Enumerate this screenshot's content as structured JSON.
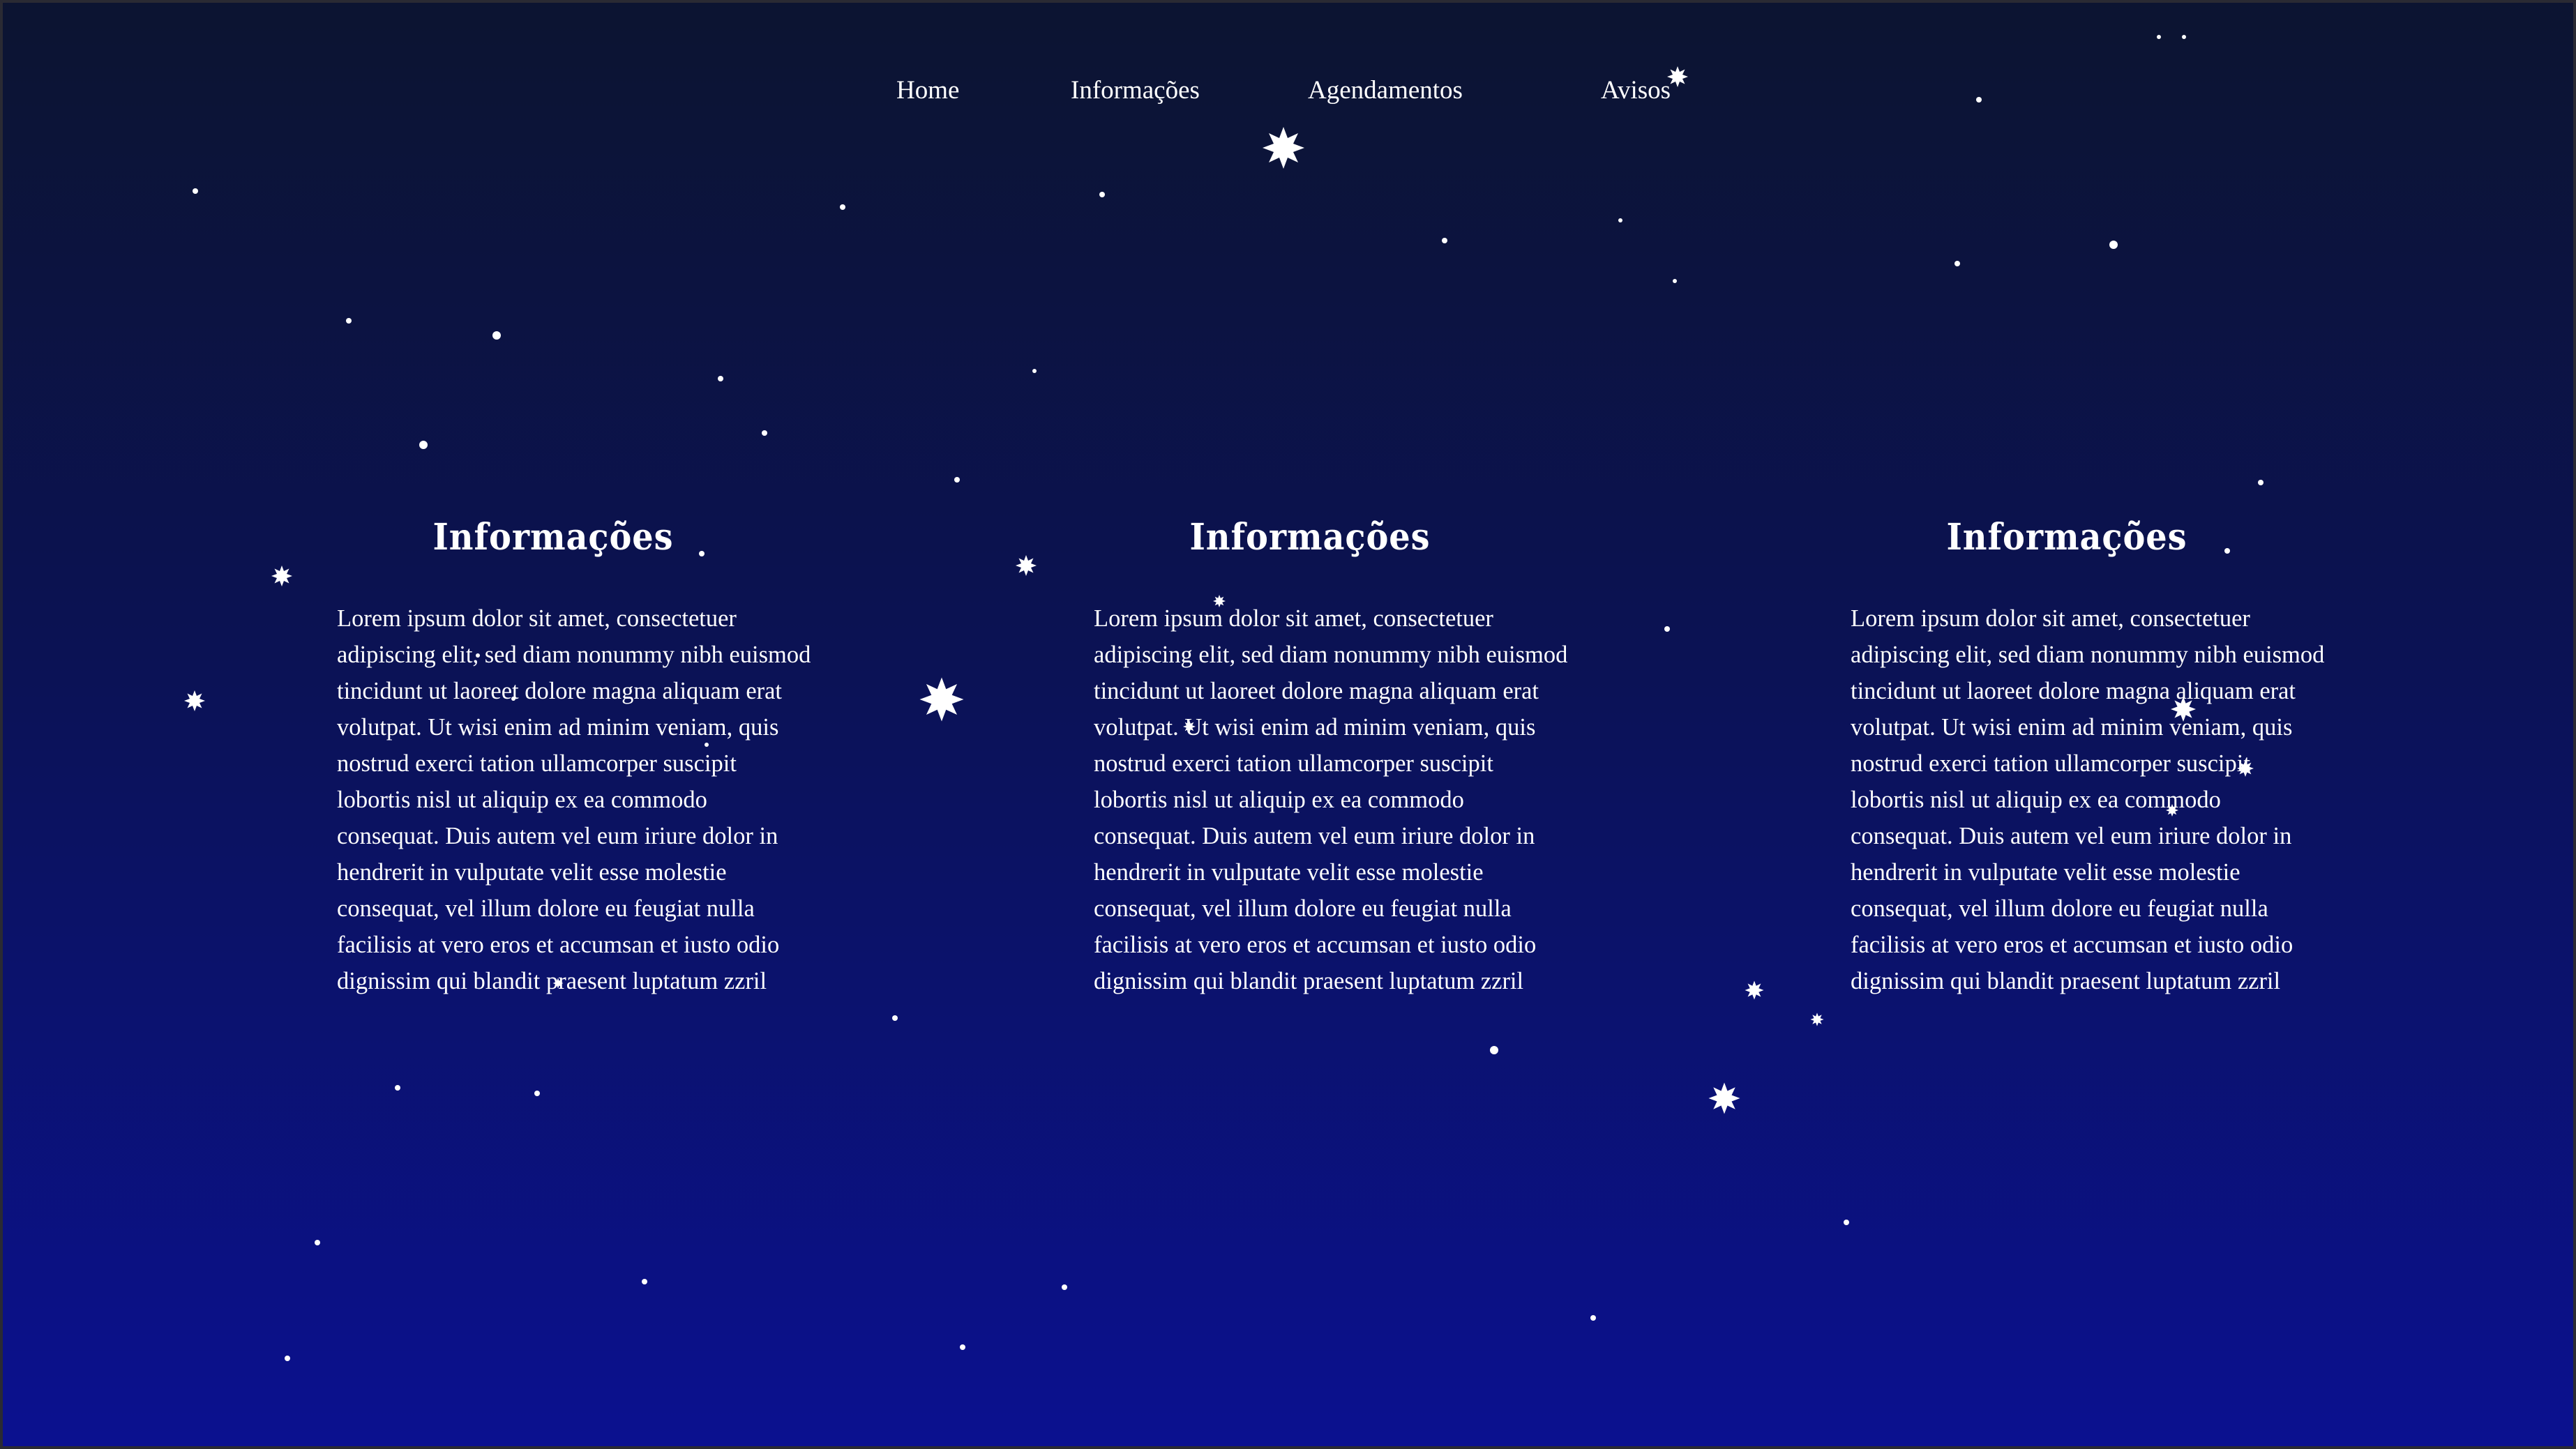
{
  "nav": {
    "items": [
      {
        "label": "Home"
      },
      {
        "label": "Informações"
      },
      {
        "label": "Agendamentos"
      },
      {
        "label": "Avisos"
      }
    ]
  },
  "columns": [
    {
      "title": "Informações",
      "body": "Lorem ipsum dolor sit amet, consectetuer adipiscing elit, sed diam nonummy nibh euismod tincidunt ut laoreet dolore magna aliquam erat volutpat. Ut wisi enim ad minim veniam, quis nostrud exerci tation ullamcorper suscipit lobortis nisl ut aliquip ex ea commodo consequat. Duis autem vel eum iriure dolor in hendrerit in vulputate velit esse molestie consequat, vel illum dolore eu feugiat nulla facilisis at vero eros et accumsan et iusto odio dignissim qui blandit praesent luptatum zzril"
    },
    {
      "title": "Informações",
      "body": "Lorem ipsum dolor sit amet, consectetuer adipiscing elit, sed diam nonummy nibh euismod tincidunt ut laoreet dolore magna aliquam erat volutpat. Ut wisi enim ad minim veniam, quis nostrud exerci tation ullamcorper suscipit lobortis nisl ut aliquip ex ea commodo consequat. Duis autem vel eum iriure dolor in hendrerit in vulputate velit esse molestie consequat, vel illum dolore eu feugiat nulla facilisis at vero eros et accumsan et iusto odio dignissim qui blandit praesent luptatum zzril"
    },
    {
      "title": "Informações",
      "body": "Lorem ipsum dolor sit amet, consectetuer adipiscing elit, sed diam nonummy nibh euismod tincidunt ut laoreet dolore magna aliquam erat volutpat. Ut wisi enim ad minim veniam, quis nostrud exerci tation ullamcorper suscipit lobortis nisl ut aliquip ex ea commodo consequat. Duis autem vel eum iriure dolor in hendrerit in vulputate velit esse molestie consequat, vel illum dolore eu feugiat nulla facilisis at vero eros et accumsan et iusto odio dignissim qui blandit praesent luptatum zzril"
    }
  ],
  "colors": {
    "background_top": "#0c1431",
    "background_bottom": "#0b1190",
    "text": "#ffffff",
    "stars": "#ffffff"
  }
}
